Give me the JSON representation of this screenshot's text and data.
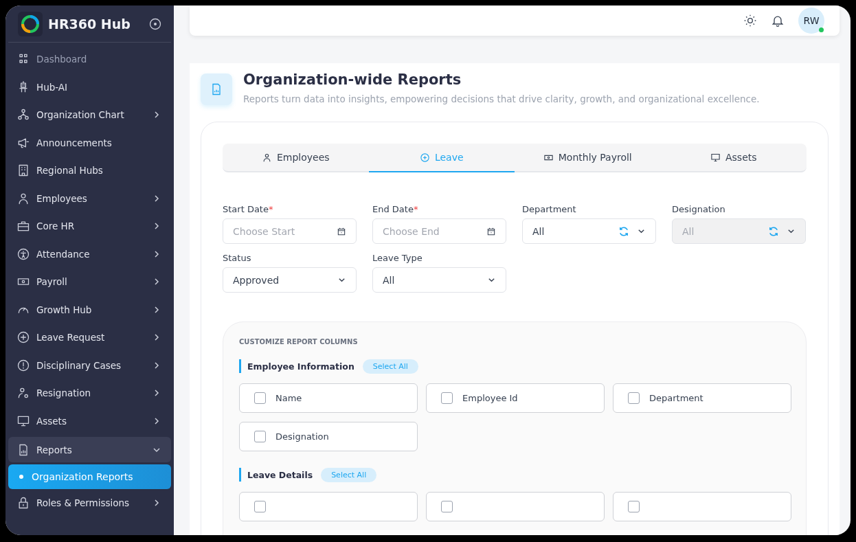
{
  "brand": {
    "name": "HR360 Hub"
  },
  "sidebar": {
    "items": [
      {
        "label": "Dashboard",
        "kind": "link"
      },
      {
        "label": "Hub-AI",
        "kind": "link"
      },
      {
        "label": "Organization Chart",
        "kind": "group",
        "expanded": false
      },
      {
        "label": "Announcements",
        "kind": "link"
      },
      {
        "label": "Regional Hubs",
        "kind": "link"
      },
      {
        "label": "Employees",
        "kind": "group",
        "expanded": false
      },
      {
        "label": "Core HR",
        "kind": "group",
        "expanded": false
      },
      {
        "label": "Attendance",
        "kind": "group",
        "expanded": false
      },
      {
        "label": "Payroll",
        "kind": "group",
        "expanded": false
      },
      {
        "label": "Growth Hub",
        "kind": "group",
        "expanded": false
      },
      {
        "label": "Leave Request",
        "kind": "group",
        "expanded": false
      },
      {
        "label": "Disciplinary Cases",
        "kind": "group",
        "expanded": false
      },
      {
        "label": "Resignation",
        "kind": "group",
        "expanded": false
      },
      {
        "label": "Assets",
        "kind": "group",
        "expanded": false
      },
      {
        "label": "Reports",
        "kind": "group",
        "expanded": true,
        "children": [
          {
            "label": "Organization Reports",
            "selected": true
          }
        ]
      },
      {
        "label": "Roles & Permissions",
        "kind": "group",
        "expanded": false
      }
    ]
  },
  "header": {
    "avatar": {
      "initials": "RW",
      "online": true
    }
  },
  "page": {
    "title": "Organization-wide Reports",
    "subtitle": "Reports turn data into insights, empowering decisions that drive clarity, growth, and organizational excellence."
  },
  "tabs": [
    {
      "label": "Employees",
      "selected": false
    },
    {
      "label": "Leave",
      "selected": true
    },
    {
      "label": "Monthly Payroll",
      "selected": false
    },
    {
      "label": "Assets",
      "selected": false
    }
  ],
  "filters": [
    {
      "label": "Start Date",
      "required_mark": "*",
      "kind": "date",
      "placeholder": "Choose Start",
      "disabled": false
    },
    {
      "label": "End Date",
      "required_mark": "*",
      "kind": "date",
      "placeholder": "Choose End",
      "disabled": false
    },
    {
      "label": "Department",
      "kind": "select-refresh",
      "value": "All",
      "disabled": false
    },
    {
      "label": "Designation",
      "kind": "select-refresh",
      "value": "All",
      "disabled": true
    },
    {
      "label": "Status",
      "kind": "select",
      "value": "Approved",
      "disabled": false
    },
    {
      "label": "Leave Type",
      "kind": "select",
      "value": "All",
      "disabled": false
    }
  ],
  "columns_panel": {
    "title": "CUSTOMIZE REPORT COLUMNS",
    "sections": [
      {
        "title": "Employee Information",
        "select_all": "Select All",
        "options": [
          {
            "label": "Name",
            "checked": false
          },
          {
            "label": "Employee Id",
            "checked": false
          },
          {
            "label": "Department",
            "checked": false
          },
          {
            "label": "Designation",
            "checked": false
          }
        ]
      },
      {
        "title": "Leave Details",
        "select_all": "Select All",
        "options": [
          {
            "checked": false
          },
          {
            "checked": false
          },
          {
            "checked": false
          }
        ]
      }
    ]
  }
}
